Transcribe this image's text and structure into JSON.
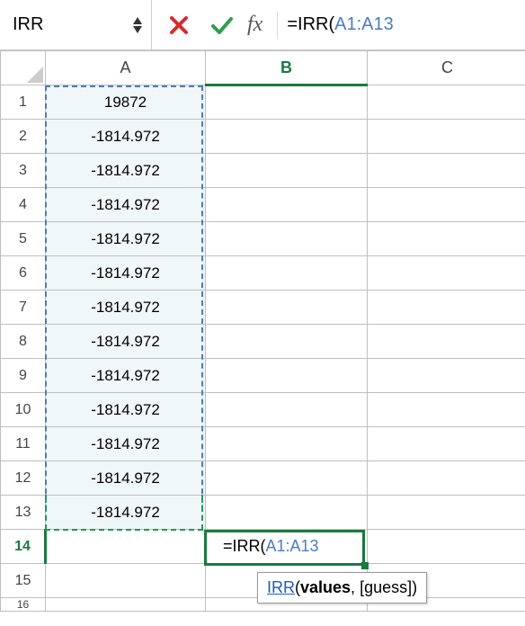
{
  "formulaBar": {
    "nameBox": "IRR",
    "fxLabel": "fx",
    "formulaPrefix": "=IRR(",
    "formulaRef": "A1:A13"
  },
  "columns": [
    "A",
    "B",
    "C"
  ],
  "rowHeaders": [
    "1",
    "2",
    "3",
    "4",
    "5",
    "6",
    "7",
    "8",
    "9",
    "10",
    "11",
    "12",
    "13",
    "14",
    "15",
    "16"
  ],
  "cellsA": {
    "1": "19872",
    "2": "-1814.972",
    "3": "-1814.972",
    "4": "-1814.972",
    "5": "-1814.972",
    "6": "-1814.972",
    "7": "-1814.972",
    "8": "-1814.972",
    "9": "-1814.972",
    "10": "-1814.972",
    "11": "-1814.972",
    "12": "-1814.972",
    "13": "-1814.972"
  },
  "activeCell": {
    "display": {
      "prefix": "=IRR(",
      "ref": "A1:A13"
    }
  },
  "tooltip": {
    "fn": "IRR",
    "open": "(",
    "arg1": "values",
    "sep": ", ",
    "arg2": "[guess]",
    "close": ")"
  }
}
